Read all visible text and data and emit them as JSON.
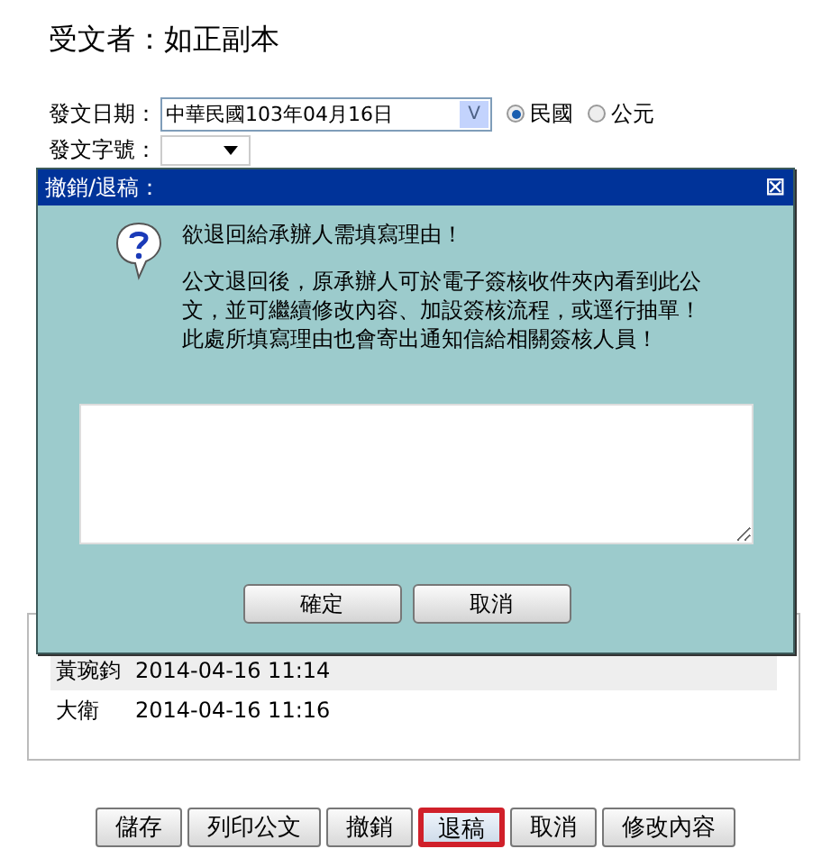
{
  "recipient": {
    "label": "受文者：",
    "value": "如正副本"
  },
  "date_field": {
    "label": "發文日期：",
    "value": "中華民國103年04月16日",
    "button": "V"
  },
  "calendar_options": [
    {
      "label": "民國",
      "selected": true
    },
    {
      "label": "公元",
      "selected": false
    }
  ],
  "doc_number": {
    "label": "發文字號："
  },
  "sign_log": [
    {
      "name": "黃琬鈞",
      "time": "2014-04-16 11:14"
    },
    {
      "name": "大衛",
      "time": "2014-04-16 11:16"
    }
  ],
  "buttons": [
    {
      "label": "儲存",
      "selected": false
    },
    {
      "label": "列印公文",
      "selected": false
    },
    {
      "label": "撤銷",
      "selected": false
    },
    {
      "label": "退稿",
      "selected": true
    },
    {
      "label": "取消",
      "selected": false
    },
    {
      "label": "修改內容",
      "selected": false
    }
  ],
  "dialog": {
    "title": "撤銷/退稿：",
    "close": "⊠",
    "heading": "欲退回給承辦人需填寫理由！",
    "message": "公文退回後，原承辦人可於電子簽核收件夾內看到此公文，並可繼續修改內容、加設簽核流程，或逕行抽單！此處所填寫理由也會寄出通知信給相關簽核人員！",
    "buttons": [
      "確定",
      "取消"
    ]
  }
}
